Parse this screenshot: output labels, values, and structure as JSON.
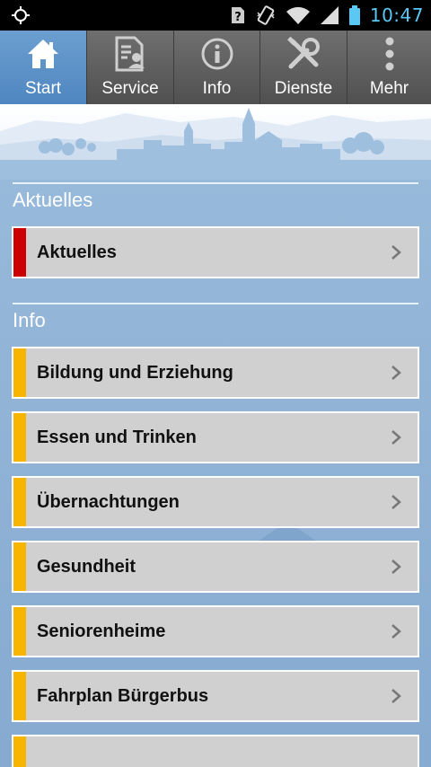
{
  "status_bar": {
    "time": "10:47"
  },
  "nav": {
    "tabs": [
      {
        "label": "Start",
        "icon": "home-icon",
        "active": true
      },
      {
        "label": "Service",
        "icon": "document-person-icon",
        "active": false
      },
      {
        "label": "Info",
        "icon": "info-icon",
        "active": false
      },
      {
        "label": "Dienste",
        "icon": "tools-icon",
        "active": false
      },
      {
        "label": "Mehr",
        "icon": "more-vertical-icon",
        "active": false
      }
    ]
  },
  "sections": [
    {
      "title": "Aktuelles",
      "items": [
        {
          "label": "Aktuelles"
        }
      ]
    },
    {
      "title": "Info",
      "items": [
        {
          "label": "Bildung und Erziehung"
        },
        {
          "label": "Essen und Trinken"
        },
        {
          "label": "Übernachtungen"
        },
        {
          "label": "Gesundheit"
        },
        {
          "label": "Seniorenheime"
        },
        {
          "label": "Fahrplan Bürgerbus"
        }
      ]
    }
  ],
  "colors": {
    "accent_active_tab": "#5b8fc7",
    "aktuelles_marker": "#cc0000",
    "info_marker": "#f7b500",
    "status_time": "#5ac8f5"
  }
}
